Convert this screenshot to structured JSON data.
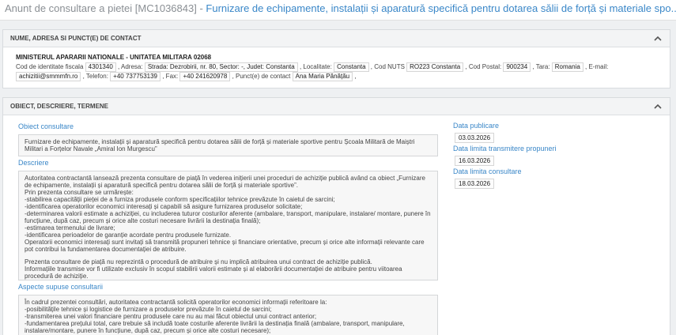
{
  "header": {
    "prefix": "Anunt de consultare a pietei [MC1036843] -",
    "title": "Furnizare de echipamente, instalații și aparatură specifică pentru dotarea sălii de forță și materiale spo..."
  },
  "contact_panel": {
    "title": "NUME, ADRESA SI PUNCT(E) DE CONTACT",
    "org_name": "MINISTERUL APARARII NATIONALE - UNITATEA MILITARA 02068",
    "fields": {
      "fiscal_code_label": "Cod de identitate fiscala",
      "fiscal_code": "4301340",
      "address_label": ", Adresa:",
      "address": "Strada: Dezrobirii, nr. 80, Sector: -, Judet: Constanta",
      "locality_label": ", Localitate:",
      "locality": "Constanta",
      "nuts_label": ", Cod NUTS",
      "nuts": "RO223 Constanta",
      "postal_label": ", Cod Postal:",
      "postal": "900234",
      "country_label": ", Tara:",
      "country": "Romania",
      "email_label": ", E-mail:",
      "email": "achizitii@smmmfn.ro",
      "phone_label": ", Telefon:",
      "phone": "+40 737753139",
      "fax_label": ", Fax:",
      "fax": "+40 241620978",
      "contact_label": ", Punct(e) de contact",
      "contact": "Ana Maria Pănățău",
      "end": ","
    }
  },
  "object_panel": {
    "title": "OBIECT, DESCRIERE, TERMENE",
    "subject_label": "Obiect consultare",
    "subject": "Furnizare de echipamente, instalații și aparatură specifică pentru dotarea sălii de forță și materiale sportive pentru Școala Militară de Maiștri Militari a Forțelor Navale „Amiral Ion Murgescu”",
    "description_label": "Descriere",
    "description_lines": [
      "Autoritatea contractantă lansează prezenta consultare de piață în vederea inițierii unei proceduri de achiziție publică având ca obiect „Furnizare de echipamente, instalații și aparatură specifică pentru dotarea sălii de forță și materiale sportive”.",
      "Prin prezenta consultare se urmărește:",
      "-stabilirea capacității pieței de a furniza produsele conform specificațiilor tehnice prevăzute în caietul de sarcini;",
      "-identificarea operatorilor economici interesați și capabili să asigure furnizarea produselor solicitate;",
      "-determinarea valorii estimate a achiziției, cu includerea tuturor costurilor aferente (ambalare, transport, manipulare, instalare/ montare, punere în funcțiune, după caz, precum și orice alte costuri necesare livrării la destinația finală);",
      "-estimarea termenului de livrare;",
      "-identificarea perioadelor de garanție acordate pentru produsele furnizate.",
      "Operatorii economici interesați sunt invitați să transmită propuneri tehnice și financiare orientative, precum și orice alte informații relevante care pot contribui la fundamentarea documentației de atribuire."
    ],
    "description_note": [
      "Prezenta consultare de piață nu reprezintă o procedură de atribuire și nu implică atribuirea unui contract de achiziție publică.",
      "Informațiile transmise vor fi utilizate exclusiv în scopul stabilirii valorii estimate și al elaborării documentației de atribuire pentru viitoarea procedură de achiziție."
    ],
    "aspects_label": "Aspecte supuse consultarii",
    "aspects_lines": [
      "În cadrul prezentei consultări, autoritatea contractantă solicită operatorilor economici informații referitoare la:",
      "-posibilitățile tehnice și logistice de furnizare a produselor prevăzute în caietul de sarcini;",
      "-transmiterea unei valori financiare pentru produsele care nu au mai făcut obiectul unui contract anterior;",
      "-fundamentarea prețului total, care trebuie să includă toate costurile aferente livrării la destinația finală (ambalare, transport, manipulare, instalare/montare, punere în funcțiune, după caz, precum și orice alte costuri necesare);"
    ],
    "publish_label": "Data publicare",
    "publish_date": "03.03.2026",
    "deadline_proposals_label": "Data limita transmitere propuneri",
    "deadline_proposals": "16.03.2026",
    "deadline_consultation_label": "Data limita consultare",
    "deadline_consultation": "18.03.2026"
  }
}
